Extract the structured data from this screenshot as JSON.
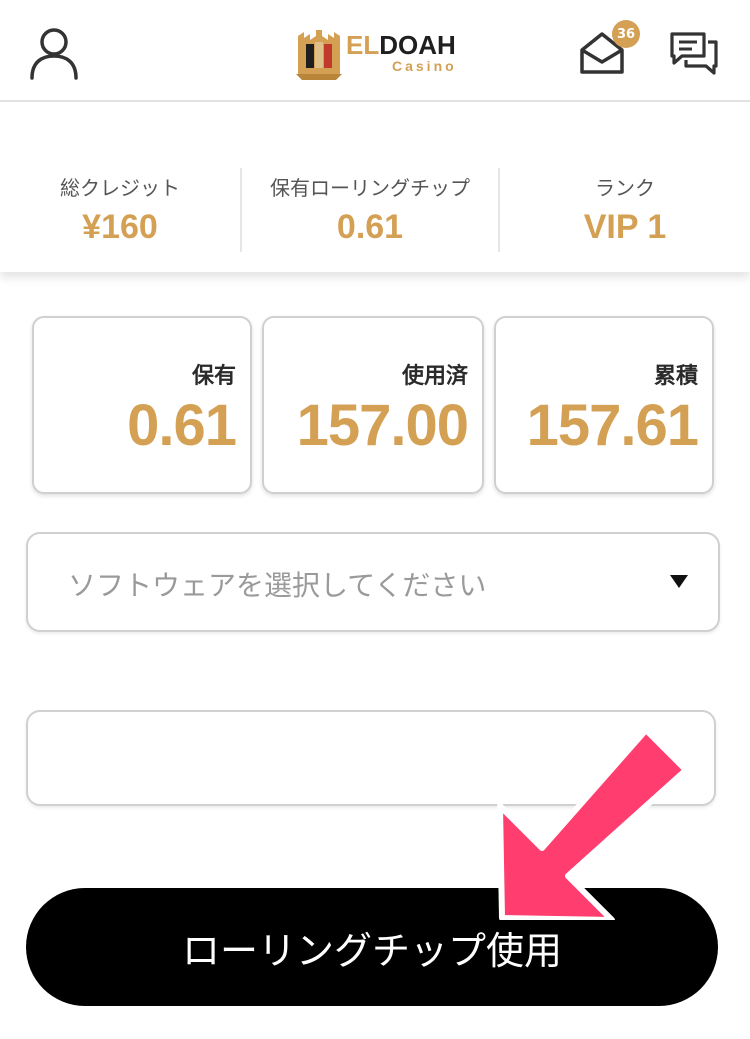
{
  "header": {
    "user_icon": "user-icon",
    "logo_text_prefix": "EL",
    "logo_text_main": "DOAH",
    "logo_subtext": "Casino",
    "mail_icon": "envelope-icon",
    "mail_badge_count": "36",
    "chat_icon": "chat-bubbles-icon"
  },
  "summary": {
    "credit_label": "総クレジット",
    "credit_value": "¥160",
    "rolling_label": "保有ローリングチップ",
    "rolling_value": "0.61",
    "rank_label": "ランク",
    "rank_value": "VIP 1"
  },
  "cards": {
    "held_label": "保有",
    "held_value": "0.61",
    "used_label": "使用済",
    "used_value": "157.00",
    "total_label": "累積",
    "total_value": "157.61"
  },
  "form": {
    "software_placeholder": "ソフトウェアを選択してください",
    "amount_value": "",
    "submit_label": "ローリングチップ使用"
  },
  "colors": {
    "accent": "#d4a054",
    "annotation_arrow": "#ff3d6e",
    "button_bg": "#000000"
  }
}
